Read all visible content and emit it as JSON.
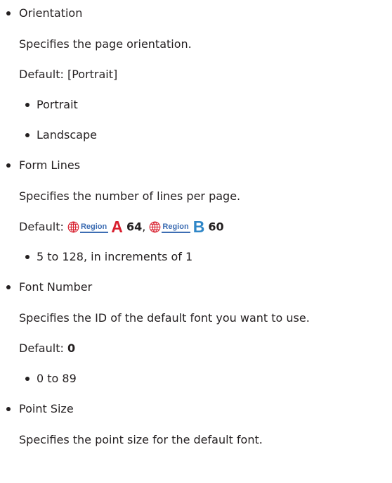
{
  "items": [
    {
      "title": "Orientation",
      "description": "Specifies the page orientation.",
      "default_label": "Default:",
      "default_value": "[Portrait]",
      "options": [
        "Portrait",
        "Landscape"
      ]
    },
    {
      "title": "Form Lines",
      "description": "Specifies the number of lines per page.",
      "default_label": "Default:",
      "region_tag": "Region",
      "regions": [
        {
          "letter": "A",
          "value": "64",
          "separator": ",",
          "letter_color": "#d8202f"
        },
        {
          "letter": "B",
          "value": "60",
          "letter_color": "#2f86c7"
        }
      ],
      "options": [
        "5 to 128, in increments of 1"
      ]
    },
    {
      "title": "Font Number",
      "description": "Specifies the ID of the default font you want to use.",
      "default_label": "Default:",
      "default_value": "0",
      "options": [
        "0 to 89"
      ]
    },
    {
      "title": "Point Size",
      "description": "Specifies the point size for the default font."
    }
  ],
  "colors": {
    "text": "#231f20",
    "region_tag": "#3d6db3"
  },
  "icons": {
    "region": "globe-icon"
  }
}
